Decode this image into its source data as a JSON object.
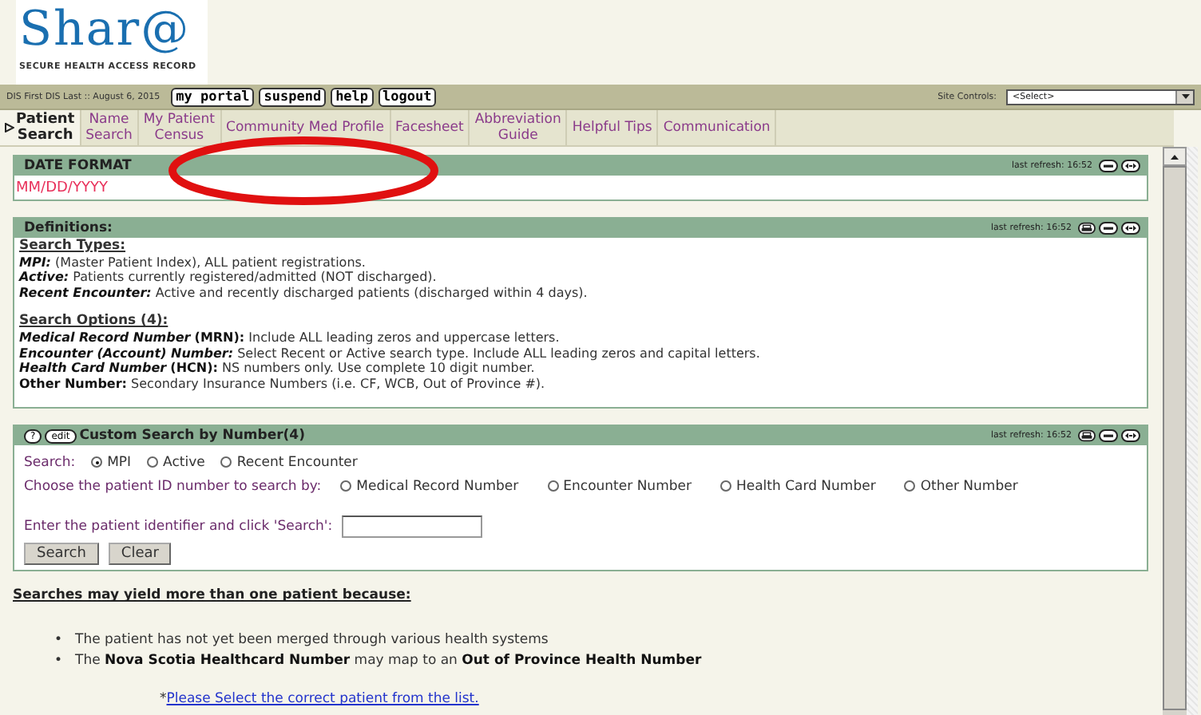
{
  "header": {
    "logo": "Shar@",
    "tagline": "SECURE HEALTH ACCESS RECORD"
  },
  "toolbar": {
    "status": "DIS First DIS Last :: August 6, 2015",
    "buttons": [
      "my portal",
      "suspend",
      "help",
      "logout"
    ],
    "site_controls_label": "Site Controls:",
    "site_controls_value": "<Select>"
  },
  "tabs": [
    {
      "label": "Patient\nSearch",
      "selected": true
    },
    {
      "label": "Name\nSearch",
      "selected": false
    },
    {
      "label": "My Patient\nCensus",
      "selected": false
    },
    {
      "label": "Community Med Profile",
      "selected": false
    },
    {
      "label": "Facesheet",
      "selected": false
    },
    {
      "label": "Abbreviation\nGuide",
      "selected": false
    },
    {
      "label": "Helpful Tips",
      "selected": false
    },
    {
      "label": "Communication",
      "selected": false
    }
  ],
  "date_panel": {
    "title": "DATE FORMAT",
    "last_refresh": "last refresh: 16:52",
    "value": "MM/DD/YYYY"
  },
  "definitions_panel": {
    "title": "Definitions:",
    "last_refresh": "last refresh: 16:52",
    "sections": [
      {
        "heading": "Search Types:",
        "items": [
          {
            "term": "MPI:",
            "italic": true,
            "text": "(Master Patient Index), ALL patient registrations."
          },
          {
            "term": "Active:",
            "italic": true,
            "text": "Patients currently registered/admitted (NOT discharged)."
          },
          {
            "term": "Recent Encounter:",
            "italic": true,
            "text": "Active and recently discharged patients (discharged within 4 days)."
          }
        ]
      },
      {
        "heading": "Search Options (4):",
        "items": [
          {
            "term": "Medical Record Number",
            "abbr": "(MRN):",
            "italic": true,
            "text": "Include ALL leading zeros and uppercase letters."
          },
          {
            "term": "Encounter (Account) Number:",
            "italic": true,
            "text": "Select Recent or Active search type. Include ALL leading zeros and capital letters."
          },
          {
            "term": "Health Card Number",
            "abbr": "(HCN):",
            "italic": true,
            "text": "NS numbers only. Use complete 10 digit number."
          },
          {
            "term": "Other Number:",
            "italic": false,
            "text": "Secondary Insurance Numbers (i.e. CF, WCB, Out of Province #)."
          }
        ]
      }
    ]
  },
  "search_panel": {
    "help": "?",
    "edit": "edit",
    "title": "Custom Search by Number(4)",
    "last_refresh": "last refresh: 16:52",
    "search_label": "Search:",
    "search_types": [
      {
        "label": "MPI",
        "selected": true
      },
      {
        "label": "Active",
        "selected": false
      },
      {
        "label": "Recent Encounter",
        "selected": false
      }
    ],
    "id_label": "Choose the patient ID number to search by:",
    "id_types": [
      {
        "label": "Medical Record Number",
        "selected": false
      },
      {
        "label": "Encounter Number",
        "selected": false
      },
      {
        "label": "Health Card Number",
        "selected": false
      },
      {
        "label": "Other Number",
        "selected": false
      }
    ],
    "identifier_label": "Enter the patient identifier and click 'Search':",
    "buttons": [
      "Search",
      "Clear"
    ]
  },
  "notes": {
    "bullet": "•",
    "heading": "Searches may yield more than one patient because:",
    "bullets": [
      "The patient has not yet been merged through various health systems",
      "The **Nova Scotia Healthcard Number** may map to an **Out of Province Health Number**"
    ],
    "prefix": "*",
    "link": "Please Select the correct patient from the list."
  }
}
